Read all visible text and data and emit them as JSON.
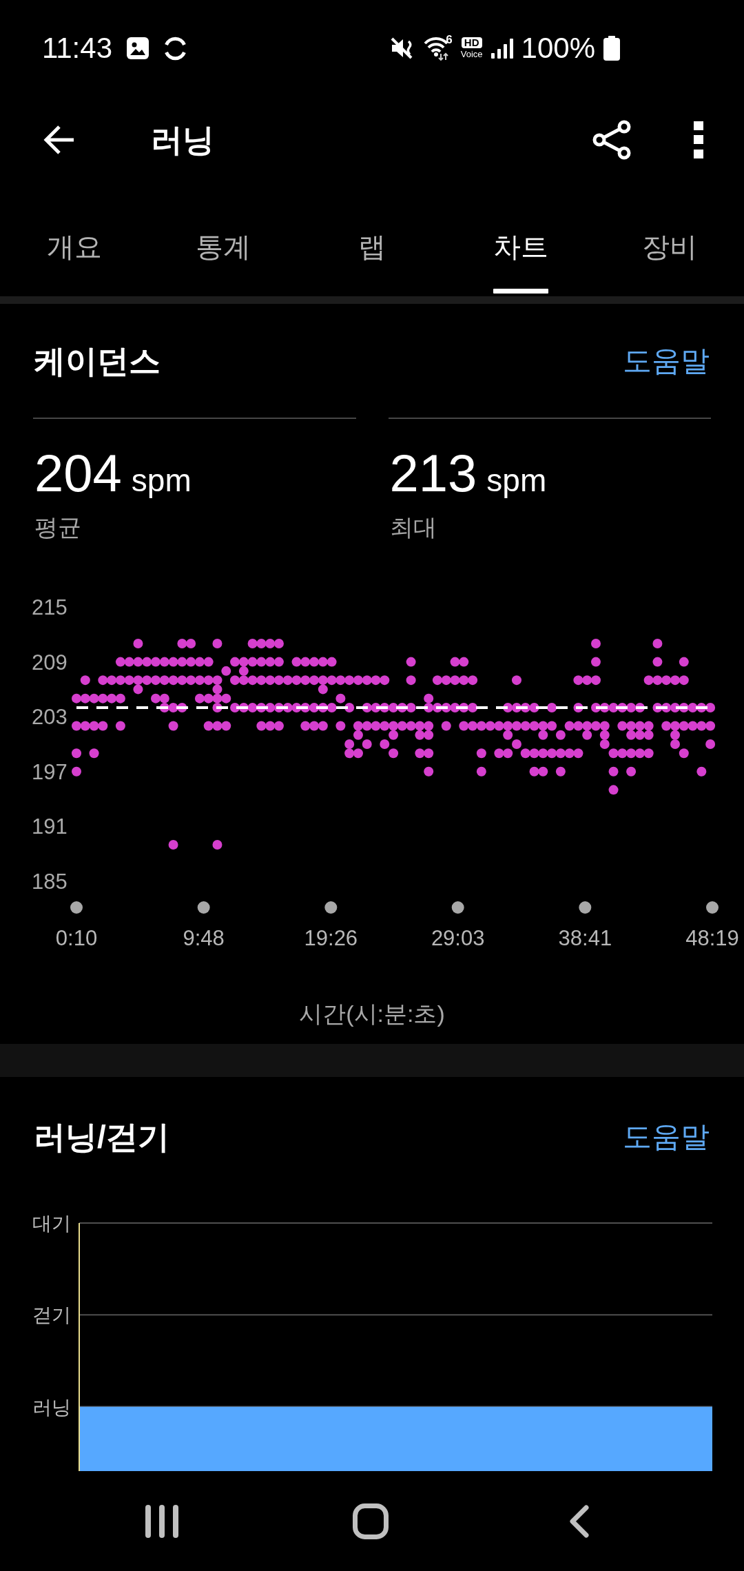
{
  "status_bar": {
    "time": "11:43",
    "wifi_label": "6",
    "hd_label": "HD",
    "voice_label": "Voice",
    "battery": "100%"
  },
  "header": {
    "title": "러닝"
  },
  "tabs": [
    {
      "label": "개요",
      "selected": false
    },
    {
      "label": "통계",
      "selected": false
    },
    {
      "label": "랩",
      "selected": false
    },
    {
      "label": "차트",
      "selected": true
    },
    {
      "label": "장비",
      "selected": false
    }
  ],
  "cadence": {
    "title": "케이던스",
    "help_link": "도움말",
    "stats": [
      {
        "value": "204",
        "unit": "spm",
        "label": "평균"
      },
      {
        "value": "213",
        "unit": "spm",
        "label": "최대"
      }
    ],
    "chart_data": {
      "type": "scatter",
      "xlabel": "시간(시:분:초)",
      "x": [
        10,
        10,
        10,
        10,
        50,
        50,
        50,
        90,
        90,
        90,
        130,
        130,
        130,
        170,
        170,
        210,
        210,
        210,
        210,
        250,
        250,
        290,
        290,
        290,
        290,
        330,
        330,
        370,
        370,
        370,
        410,
        410,
        410,
        410,
        450,
        450,
        450,
        450,
        450,
        490,
        490,
        490,
        490,
        530,
        530,
        530,
        570,
        570,
        570,
        610,
        610,
        610,
        610,
        650,
        650,
        650,
        650,
        650,
        650,
        650,
        690,
        690,
        690,
        730,
        730,
        730,
        770,
        770,
        770,
        770,
        810,
        810,
        810,
        810,
        850,
        850,
        850,
        850,
        850,
        890,
        890,
        890,
        890,
        890,
        930,
        930,
        930,
        930,
        930,
        970,
        970,
        1010,
        1010,
        1010,
        1050,
        1050,
        1050,
        1050,
        1090,
        1090,
        1090,
        1090,
        1130,
        1130,
        1130,
        1130,
        1130,
        1170,
        1170,
        1170,
        1210,
        1210,
        1210,
        1250,
        1250,
        1250,
        1250,
        1290,
        1290,
        1290,
        1290,
        1330,
        1330,
        1330,
        1330,
        1370,
        1370,
        1370,
        1410,
        1410,
        1410,
        1410,
        1450,
        1450,
        1450,
        1450,
        1490,
        1490,
        1530,
        1530,
        1530,
        1530,
        1570,
        1570,
        1570,
        1610,
        1610,
        1610,
        1610,
        1610,
        1610,
        1650,
        1650,
        1690,
        1690,
        1690,
        1730,
        1730,
        1730,
        1770,
        1770,
        1770,
        1770,
        1810,
        1810,
        1810,
        1850,
        1850,
        1850,
        1890,
        1930,
        1930,
        1970,
        1970,
        1970,
        1970,
        2010,
        2010,
        2010,
        2010,
        2050,
        2050,
        2050,
        2090,
        2090,
        2090,
        2090,
        2130,
        2130,
        2130,
        2130,
        2170,
        2170,
        2170,
        2210,
        2210,
        2210,
        2250,
        2250,
        2290,
        2290,
        2290,
        2290,
        2330,
        2330,
        2330,
        2370,
        2370,
        2370,
        2370,
        2370,
        2410,
        2410,
        2410,
        2410,
        2450,
        2450,
        2450,
        2450,
        2490,
        2490,
        2490,
        2530,
        2530,
        2530,
        2530,
        2530,
        2570,
        2570,
        2570,
        2570,
        2610,
        2610,
        2610,
        2610,
        2650,
        2650,
        2650,
        2650,
        2690,
        2690,
        2690,
        2730,
        2730,
        2730,
        2730,
        2730,
        2770,
        2770,
        2770,
        2770,
        2770,
        2810,
        2810,
        2850,
        2850,
        2850,
        2890,
        2890,
        2890
      ],
      "series": [
        {
          "color": "#d63fce",
          "values": [
            205,
            202,
            199,
            197,
            207,
            205,
            202,
            205,
            202,
            199,
            207,
            205,
            202,
            207,
            205,
            209,
            207,
            205,
            202,
            209,
            207,
            211,
            209,
            207,
            206,
            209,
            207,
            209,
            207,
            205,
            209,
            207,
            205,
            204,
            209,
            207,
            204,
            202,
            189,
            211,
            209,
            207,
            204,
            211,
            209,
            207,
            209,
            207,
            205,
            209,
            207,
            205,
            202,
            211,
            207,
            206,
            205,
            204,
            202,
            189,
            208,
            205,
            202,
            209,
            207,
            204,
            209,
            208,
            207,
            204,
            211,
            209,
            207,
            204,
            211,
            209,
            207,
            204,
            202,
            211,
            209,
            207,
            204,
            202,
            211,
            209,
            207,
            204,
            202,
            207,
            204,
            209,
            207,
            204,
            209,
            207,
            204,
            202,
            209,
            207,
            204,
            202,
            209,
            207,
            206,
            204,
            202,
            209,
            207,
            204,
            207,
            205,
            202,
            207,
            204,
            200,
            199,
            207,
            202,
            201,
            199,
            207,
            204,
            202,
            200,
            207,
            204,
            202,
            207,
            204,
            202,
            200,
            204,
            202,
            201,
            199,
            204,
            202,
            209,
            207,
            204,
            202,
            202,
            201,
            199,
            205,
            204,
            202,
            201,
            199,
            197,
            207,
            204,
            207,
            204,
            202,
            209,
            207,
            204,
            209,
            207,
            204,
            202,
            207,
            204,
            202,
            202,
            199,
            197,
            202,
            202,
            199,
            204,
            202,
            201,
            199,
            207,
            204,
            202,
            200,
            204,
            202,
            199,
            204,
            202,
            199,
            197,
            202,
            201,
            199,
            197,
            204,
            202,
            199,
            201,
            199,
            197,
            202,
            199,
            207,
            204,
            202,
            199,
            207,
            202,
            201,
            211,
            209,
            207,
            204,
            202,
            204,
            202,
            201,
            200,
            204,
            199,
            197,
            195,
            204,
            202,
            199,
            204,
            202,
            201,
            199,
            197,
            204,
            202,
            201,
            199,
            207,
            202,
            201,
            199,
            211,
            209,
            207,
            204,
            207,
            204,
            202,
            207,
            204,
            202,
            201,
            200,
            209,
            207,
            204,
            202,
            199,
            204,
            202,
            204,
            202,
            197,
            204,
            202,
            200
          ]
        }
      ],
      "xlim": [
        10,
        2899
      ],
      "ylim": [
        185,
        215
      ],
      "xticks": [
        {
          "value": 10,
          "label": "0:10"
        },
        {
          "value": 588,
          "label": "9:48"
        },
        {
          "value": 1166,
          "label": "19:26"
        },
        {
          "value": 1743,
          "label": "29:03"
        },
        {
          "value": 2321,
          "label": "38:41"
        },
        {
          "value": 2899,
          "label": "48:19"
        }
      ],
      "yticks": [
        185,
        191,
        197,
        203,
        209,
        215
      ],
      "ref_lines": [
        {
          "axis": "y",
          "value": 204
        }
      ]
    }
  },
  "running_walking": {
    "title": "러닝/걷기",
    "help_link": "도움말",
    "levels": [
      {
        "label": "대기",
        "filled": false
      },
      {
        "label": "걷기",
        "filled": false
      },
      {
        "label": "러닝",
        "filled": true
      }
    ]
  }
}
